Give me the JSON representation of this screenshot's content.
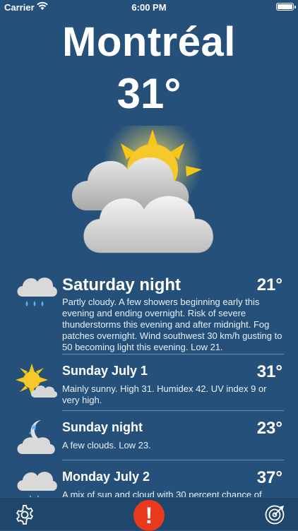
{
  "status": {
    "carrier": "Carrier",
    "time": "6:00 PM"
  },
  "current": {
    "city": "Montréal",
    "temperature": "31°",
    "icon": "partly-cloudy-icon"
  },
  "forecast": [
    {
      "title": "Saturday night",
      "temp": "21°",
      "icon": "rain-cloud-icon",
      "description": "Partly cloudy. A few showers beginning early this evening and ending overnight. Risk of severe thunderstorms this evening and after midnight. Fog patches overnight. Wind southwest 30 km/h gusting to 50 becoming light this evening. Low 21."
    },
    {
      "title": "Sunday July 1",
      "temp": "31°",
      "icon": "sunny-icon",
      "description": "Mainly sunny. High 31. Humidex 42. UV index 9 or very high."
    },
    {
      "title": "Sunday night",
      "temp": "23°",
      "icon": "moon-cloud-icon",
      "description": "A few clouds. Low 23."
    },
    {
      "title": "Monday July 2",
      "temp": "37°",
      "icon": "rain-cloud-icon",
      "description": "A mix of sun and cloud with 30 percent chance of"
    }
  ],
  "toolbar": {
    "settings_icon": "gear-icon",
    "alert_label": "!",
    "radar_icon": "radar-icon"
  },
  "colors": {
    "background": "#24507a",
    "alert": "#e8391d",
    "sun": "#f5c518"
  }
}
